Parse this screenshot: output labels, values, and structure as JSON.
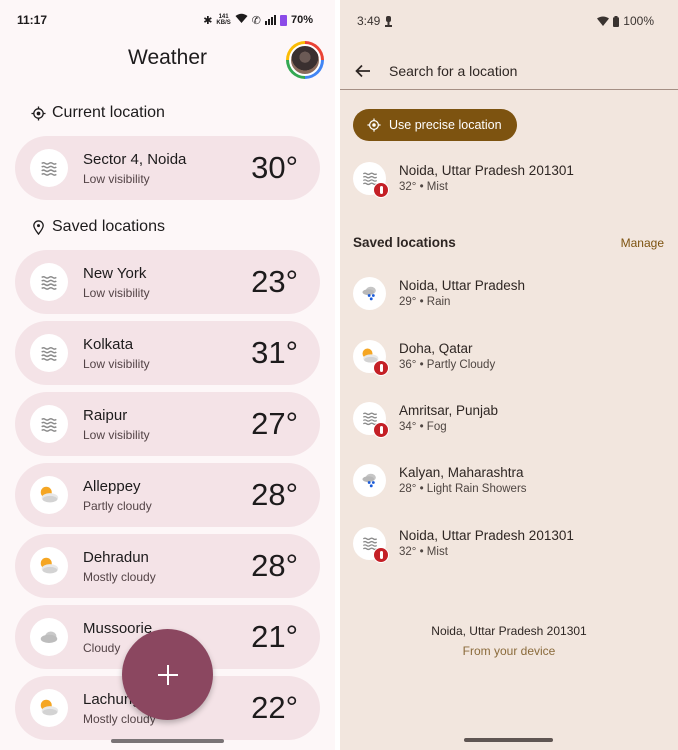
{
  "left": {
    "status_bar": {
      "time": "11:17",
      "net_speed": "141",
      "net_unit": "KB/S",
      "battery": "70%"
    },
    "title": "Weather",
    "avatar_label": "Account avatar",
    "current_section": "Current location",
    "current": {
      "name": "Sector 4, Noida",
      "condition": "Low visibility",
      "temp": "30°",
      "icon": "haze-icon"
    },
    "saved_section": "Saved locations",
    "saved": [
      {
        "name": "New York",
        "condition": "Low visibility",
        "temp": "23°",
        "icon": "haze"
      },
      {
        "name": "Kolkata",
        "condition": "Low visibility",
        "temp": "31°",
        "icon": "haze"
      },
      {
        "name": "Raipur",
        "condition": "Low visibility",
        "temp": "27°",
        "icon": "haze"
      },
      {
        "name": "Alleppey",
        "condition": "Partly cloudy",
        "temp": "28°",
        "icon": "partly-cloudy"
      },
      {
        "name": "Dehradun",
        "condition": "Mostly cloudy",
        "temp": "28°",
        "icon": "partly-cloudy"
      },
      {
        "name": "Mussoorie",
        "condition": "Cloudy",
        "temp": "21°",
        "icon": "cloudy"
      },
      {
        "name": "Lachung",
        "condition": "Mostly cloudy",
        "temp": "22°",
        "icon": "partly-cloudy"
      }
    ],
    "fab_label": "Add location",
    "colors": {
      "background": "#fdf7f8",
      "card": "#f4e3e7",
      "fab": "#8b4760"
    }
  },
  "right": {
    "status_bar": {
      "time": "3:49",
      "battery": "100%"
    },
    "search_placeholder": "Search for a location",
    "precise_button": "Use precise location",
    "current": {
      "name": "Noida, Uttar Pradesh 201301",
      "detail": "32° • Mist",
      "icon": "haze",
      "alert": true
    },
    "saved_section": "Saved locations",
    "manage_label": "Manage",
    "saved": [
      {
        "name": "Noida, Uttar Pradesh",
        "detail": "29° • Rain",
        "icon": "rain",
        "alert": false
      },
      {
        "name": "Doha, Qatar",
        "detail": "36° • Partly Cloudy",
        "icon": "partly-cloudy",
        "alert": true
      },
      {
        "name": "Amritsar, Punjab",
        "detail": "34° • Fog",
        "icon": "haze",
        "alert": true
      },
      {
        "name": "Kalyan, Maharashtra",
        "detail": "28° • Light Rain Showers",
        "icon": "rain",
        "alert": false
      },
      {
        "name": "Noida, Uttar Pradesh 201301",
        "detail": "32° • Mist",
        "icon": "haze",
        "alert": true
      }
    ],
    "footer": {
      "location": "Noida, Uttar Pradesh 201301",
      "source": "From your device"
    },
    "colors": {
      "background": "#f2e6de",
      "accent": "#7d5310",
      "alert": "#c42026"
    }
  }
}
